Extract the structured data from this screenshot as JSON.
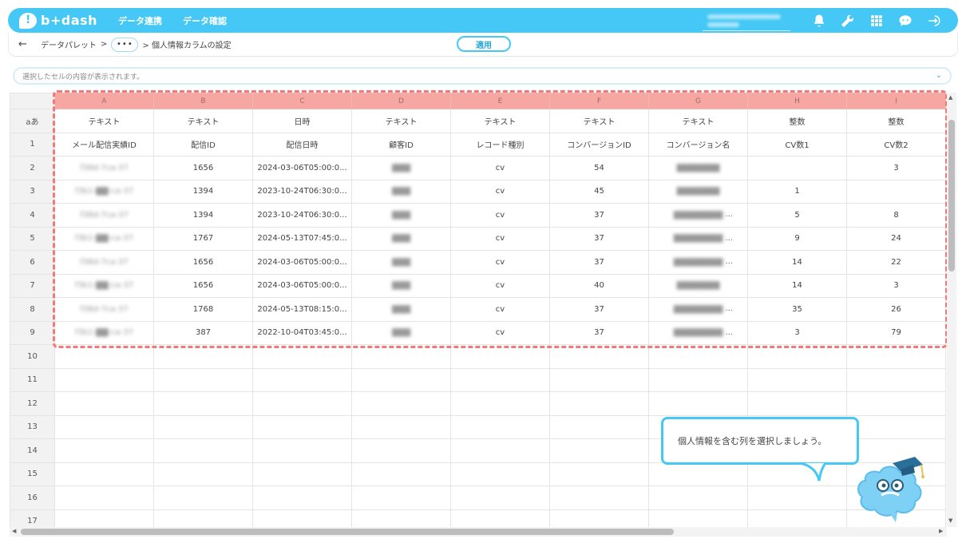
{
  "app": {
    "logo_text": "b+dash",
    "nav": [
      "データ連携",
      "データ確認"
    ],
    "accent_color": "#45c8f5"
  },
  "top_icons": [
    "bell-icon",
    "wrench-icon",
    "grid-icon",
    "chat-icon",
    "logout-icon"
  ],
  "breadcrumb": {
    "root": "データパレット",
    "sep": ">",
    "more": "•••",
    "current": "> 個人情報カラムの設定"
  },
  "toolbar": {
    "apply_label": "適用"
  },
  "cellbar": {
    "placeholder": "選択したセルの内容が表示されます。"
  },
  "grid": {
    "corner_type_label": "aあ",
    "columns": [
      {
        "letter": "A",
        "type": "テキスト",
        "name": "メール配信実績ID"
      },
      {
        "letter": "B",
        "type": "テキスト",
        "name": "配信ID"
      },
      {
        "letter": "C",
        "type": "日時",
        "name": "配信日時"
      },
      {
        "letter": "D",
        "type": "テキスト",
        "name": "顧客ID"
      },
      {
        "letter": "E",
        "type": "テキスト",
        "name": "レコード種別"
      },
      {
        "letter": "F",
        "type": "テキスト",
        "name": "コンバージョンID"
      },
      {
        "letter": "G",
        "type": "テキスト",
        "name": "コンバージョン名"
      },
      {
        "letter": "H",
        "type": "整数",
        "name": "CV数1"
      },
      {
        "letter": "I",
        "type": "整数",
        "name": "CV数2"
      }
    ],
    "row_numbers": [
      "1",
      "2",
      "3",
      "4",
      "5",
      "6",
      "7",
      "8",
      "9",
      "10",
      "11",
      "12",
      "13",
      "14",
      "15",
      "16",
      "17"
    ],
    "rows": [
      {
        "a": "f38d-7ca-37",
        "b": "1656",
        "c": "2024-03-06T05:00:0...",
        "d": "▇▇▇",
        "e": "cv",
        "f": "54",
        "g": "▇▇▇▇▇▇▇",
        "g_more": "",
        "h": "",
        "i": "3"
      },
      {
        "a": "f3b1-▇▇-ca-37",
        "b": "1394",
        "c": "2023-10-24T06:30:0...",
        "d": "▇▇▇",
        "e": "cv",
        "f": "45",
        "g": "▇▇▇▇▇▇▇",
        "g_more": "",
        "h": "1",
        "i": ""
      },
      {
        "a": "f38d-7ca-37",
        "b": "1394",
        "c": "2023-10-24T06:30:0...",
        "d": "▇▇▇",
        "e": "cv",
        "f": "37",
        "g": "▇▇▇▇▇▇▇▇",
        "g_more": "...",
        "h": "5",
        "i": "8"
      },
      {
        "a": "f3b1-▇▇-ca-37",
        "b": "1767",
        "c": "2024-05-13T07:45:0...",
        "d": "▇▇▇",
        "e": "cv",
        "f": "37",
        "g": "▇▇▇▇▇▇▇▇",
        "g_more": "...",
        "h": "9",
        "i": "24"
      },
      {
        "a": "f38d-7ca-37",
        "b": "1656",
        "c": "2024-03-06T05:00:0...",
        "d": "▇▇▇",
        "e": "cv",
        "f": "37",
        "g": "▇▇▇▇▇▇▇▇",
        "g_more": "...",
        "h": "14",
        "i": "22"
      },
      {
        "a": "f3b1-▇▇-ca-37",
        "b": "1656",
        "c": "2024-03-06T05:00:0...",
        "d": "▇▇▇",
        "e": "cv",
        "f": "40",
        "g": "▇▇▇▇▇▇▇",
        "g_more": "",
        "h": "14",
        "i": "3"
      },
      {
        "a": "f38d-7ca-37",
        "b": "1768",
        "c": "2024-05-13T08:15:0...",
        "d": "▇▇▇",
        "e": "cv",
        "f": "37",
        "g": "▇▇▇▇▇▇▇▇",
        "g_more": "...",
        "h": "35",
        "i": "26"
      },
      {
        "a": "f3b1-▇▇-ca-37",
        "b": "387",
        "c": "2022-10-04T03:45:0...",
        "d": "▇▇▇",
        "e": "cv",
        "f": "37",
        "g": "▇▇▇▇▇▇▇▇",
        "g_more": "...",
        "h": "3",
        "i": "79"
      }
    ]
  },
  "tooltip": {
    "text": "個人情報を含む列を選択しましょう。"
  }
}
